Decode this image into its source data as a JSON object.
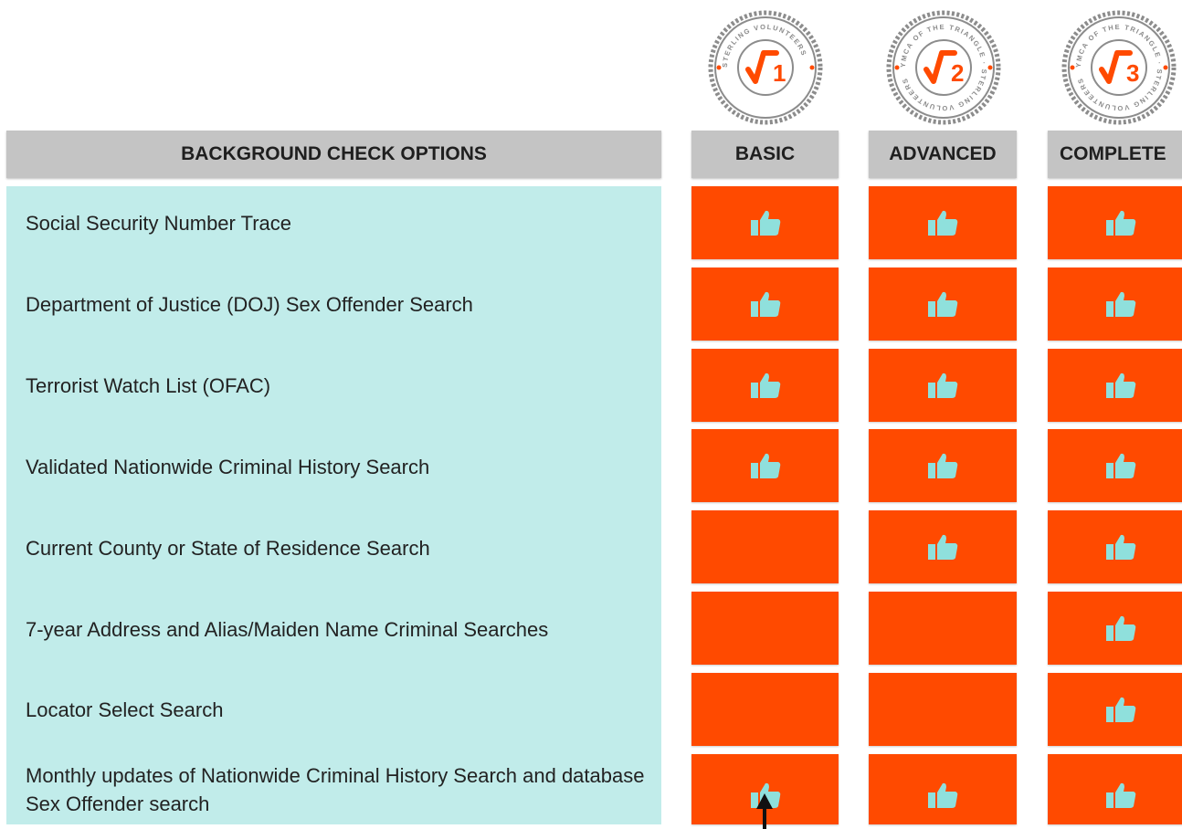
{
  "columns": {
    "options": "BACKGROUND CHECK OPTIONS",
    "basic": "BASIC",
    "advanced": "ADVANCED",
    "complete": "COMPLETE"
  },
  "badges": [
    {
      "number": "1",
      "ring_text": "STERLING VOLUNTEERS"
    },
    {
      "number": "2",
      "ring_text": "YMCA OF THE TRIANGLE · STERLING VOLUNTEERS"
    },
    {
      "number": "3",
      "ring_text": "YMCA OF THE TRIANGLE · STERLING VOLUNTEERS"
    }
  ],
  "rows": [
    {
      "label": "Social Security Number Trace",
      "basic": true,
      "advanced": true,
      "complete": true
    },
    {
      "label": "Department of Justice (DOJ) Sex Offender Search",
      "basic": true,
      "advanced": true,
      "complete": true
    },
    {
      "label": "Terrorist Watch List (OFAC)",
      "basic": true,
      "advanced": true,
      "complete": true
    },
    {
      "label": "Validated Nationwide Criminal History Search",
      "basic": true,
      "advanced": true,
      "complete": true
    },
    {
      "label": "Current County or State of Residence Search",
      "basic": false,
      "advanced": true,
      "complete": true
    },
    {
      "label": "7-year Address and Alias/Maiden Name Criminal Searches",
      "basic": false,
      "advanced": false,
      "complete": true
    },
    {
      "label": "Locator Select Search",
      "basic": false,
      "advanced": false,
      "complete": true
    },
    {
      "label": "Monthly updates of Nationwide Criminal History Search and database Sex Offender search",
      "basic": true,
      "advanced": true,
      "complete": true
    }
  ],
  "icons": {
    "included": "thumbs-up-icon",
    "badge": "checkmark-seal-icon"
  },
  "colors": {
    "cell": "#ff4a00",
    "thumb": "#8fe0dc",
    "panel": "#c1ecea",
    "header": "#c4c4c4",
    "badge_check": "#ff4a00",
    "badge_ring": "#8c8c8c"
  }
}
